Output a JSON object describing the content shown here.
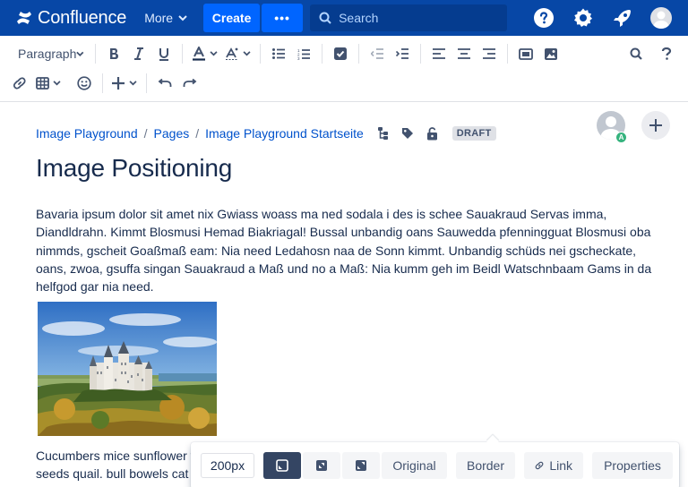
{
  "colors": {
    "nav_bg": "#0747a6",
    "primary": "#0065ff",
    "link": "#0052cc",
    "text": "#172b4d"
  },
  "topnav": {
    "logo_text": "Confluence",
    "more_label": "More",
    "create_label": "Create",
    "dots_label": "•••",
    "search_placeholder": "Search",
    "icons": [
      "help-icon",
      "settings-icon",
      "notifications-icon",
      "profile-avatar"
    ]
  },
  "toolbar": {
    "paragraph_style": "Paragraph",
    "row1_icons": [
      "bold-icon",
      "italic-icon",
      "underline-icon",
      "text-color-icon",
      "clear-format-icon",
      "bullet-list-icon",
      "numbered-list-icon",
      "task-icon",
      "outdent-icon",
      "indent-icon",
      "align-left-icon",
      "align-center-icon",
      "align-right-icon",
      "layouts-icon",
      "image-icon"
    ],
    "row1_right_icons": [
      "find-replace-icon",
      "help-icon"
    ],
    "row2_icons": [
      "link-icon",
      "table-icon",
      "emoji-icon",
      "insert-icon",
      "undo-icon",
      "redo-icon"
    ]
  },
  "breadcrumb": {
    "items": [
      "Image Playground",
      "Pages",
      "Image Playground Startseite"
    ],
    "separator": "/",
    "draft_label": "DRAFT"
  },
  "collaborator": {
    "badge_initial": "A"
  },
  "page": {
    "title": "Image Positioning",
    "paragraph1": "Bavaria ipsum dolor sit amet nix Gwiass woass ma ned sodala i des is schee Sauakraud Servas imma, Diandldrahn. Kimmt Blosmusi Hemad Biakriagal! Bussal unbandig oans Sauwedda pfenningguat Blosmusi oba nimmds, gscheit Goaßmaß eam: Nia need Ledahosn naa de Sonn kimmt. Unbandig schüds nei gscheckate, oans, zwoa, gsuffa singan Sauakraud a Maß und no a Maß: Nia kumm geh im Beidl Watschnbaam Gams in da helfgod gar nia need.",
    "paragraph2_line1": "Cucumbers mice sunflower w",
    "paragraph2_line2": "seeds quail. bull bowels cat c"
  },
  "image_toolbar": {
    "width_value": "200px",
    "position_buttons": [
      "align-left-position-icon",
      "align-center-position-icon",
      "full-width-position-icon"
    ],
    "original_label": "Original",
    "border_label": "Border",
    "link_label": "Link",
    "properties_label": "Properties"
  }
}
